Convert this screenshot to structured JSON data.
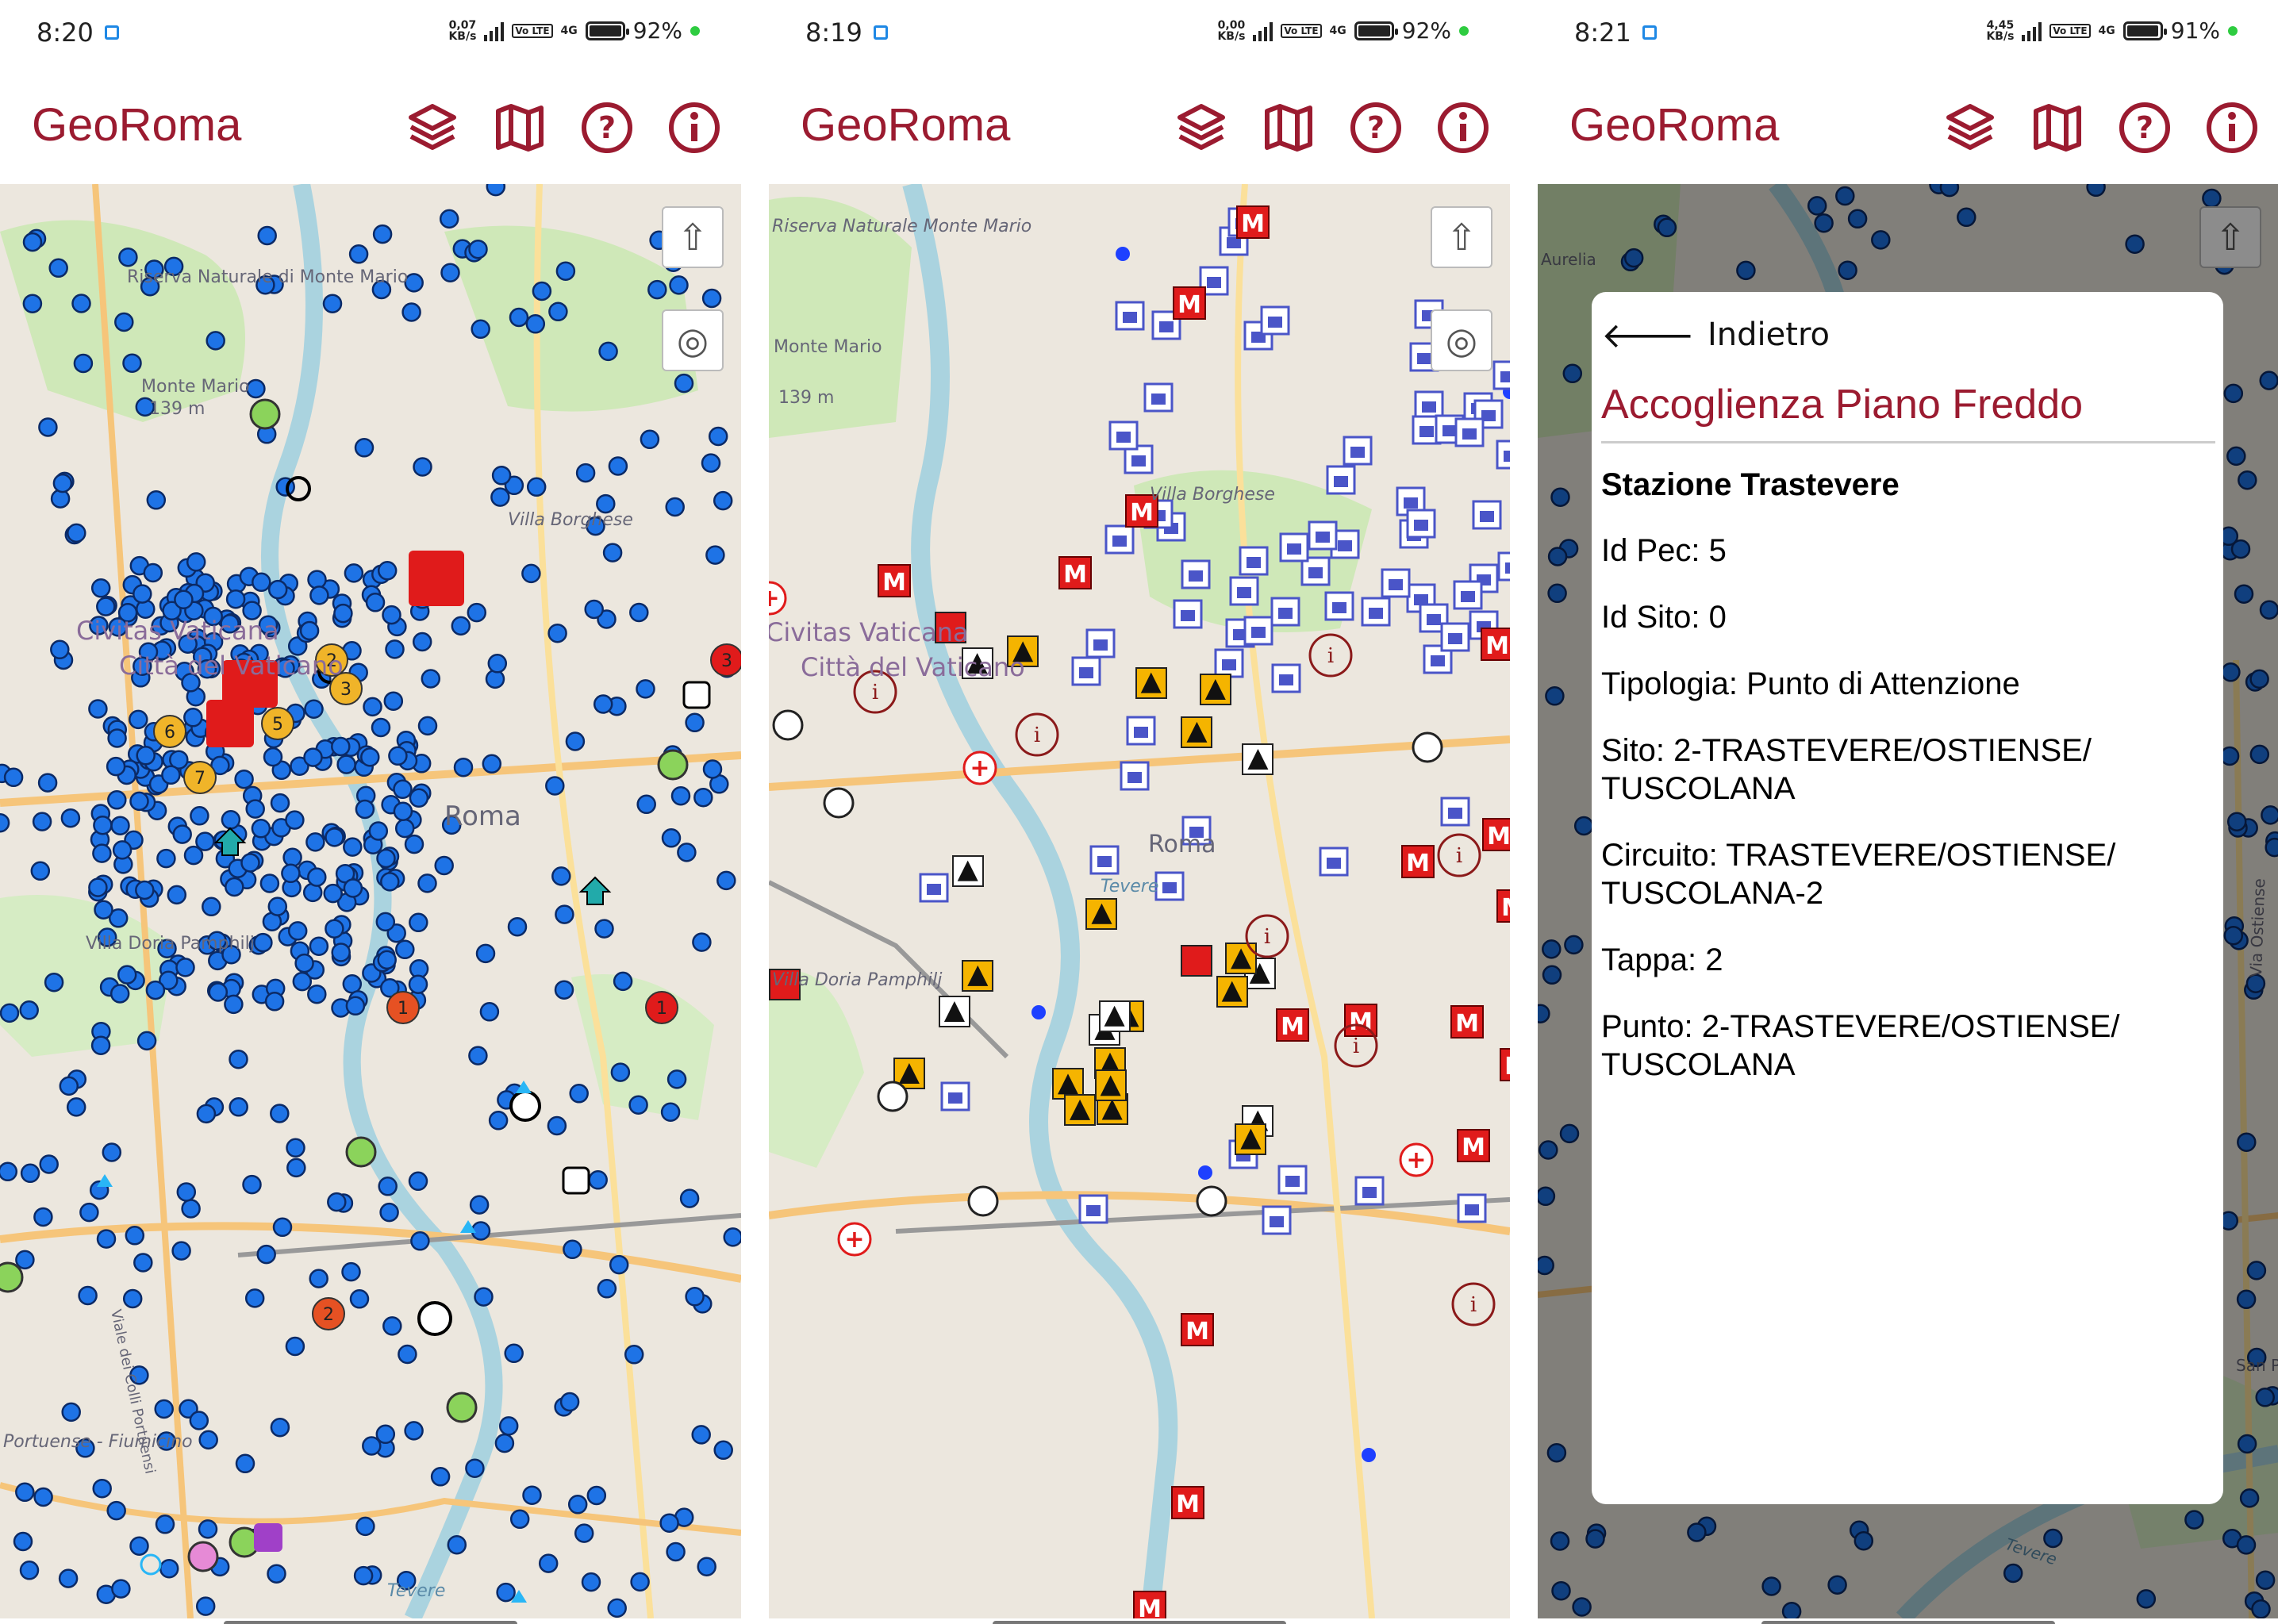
{
  "app_title": "GeoRoma",
  "colors": {
    "brand": "#9b1b30",
    "marker_blue": "#1e73e6",
    "metro_red": "#e01b1b"
  },
  "toolbar_icons": [
    "layers-icon",
    "map-icon",
    "help-icon",
    "info-icon"
  ],
  "screens": [
    {
      "status": {
        "time": "8:20",
        "speed": "0,07",
        "speed_unit": "KB/s",
        "network": "4G",
        "battery": "92%"
      },
      "map_labels": [
        "Riserva Naturale di Monte Mario",
        "Monte Mario",
        "139 m",
        "Civitas Vaticana",
        "Città del Vaticano",
        "Villa Borghese",
        "Roma",
        "Villa Doria Pamphilj",
        "Viale dei Colli Portuensi",
        "Portuense - Fiumicino",
        "Tevere"
      ],
      "cluster_numbers": [
        "1",
        "1",
        "2",
        "2",
        "3",
        "5",
        "6",
        "7"
      ]
    },
    {
      "status": {
        "time": "8:19",
        "speed": "0,00",
        "speed_unit": "KB/s",
        "network": "4G",
        "battery": "92%"
      },
      "map_labels": [
        "Riserva Naturale Monte Mario",
        "Monte Mario",
        "139 m",
        "Civitas Vaticana",
        "Città del Vaticano",
        "Villa Borghese",
        "Roma",
        "Tevere",
        "Villa Doria Pamphilj"
      ]
    },
    {
      "status": {
        "time": "8:21",
        "speed": "4,45",
        "speed_unit": "KB/s",
        "network": "4G",
        "battery": "91%"
      },
      "map_labels": [
        "Aurelia",
        "Via Ostiense",
        "Tevere",
        "San Pa"
      ],
      "detail": {
        "back_label": "Indietro",
        "title": "Accoglienza Piano Freddo",
        "subtitle": "Stazione Trastevere",
        "fields": [
          "Id Pec: 5",
          "Id Sito: 0",
          "Tipologia: Punto di Attenzione",
          "Sito: 2-TRASTEVERE/OSTIENSE/ TUSCOLANA",
          "Circuito: TRASTEVERE/OSTIENSE/ TUSCOLANA-2",
          "Tappa: 2",
          "Punto: 2-TRASTEVERE/OSTIENSE/ TUSCOLANA"
        ]
      }
    }
  ]
}
